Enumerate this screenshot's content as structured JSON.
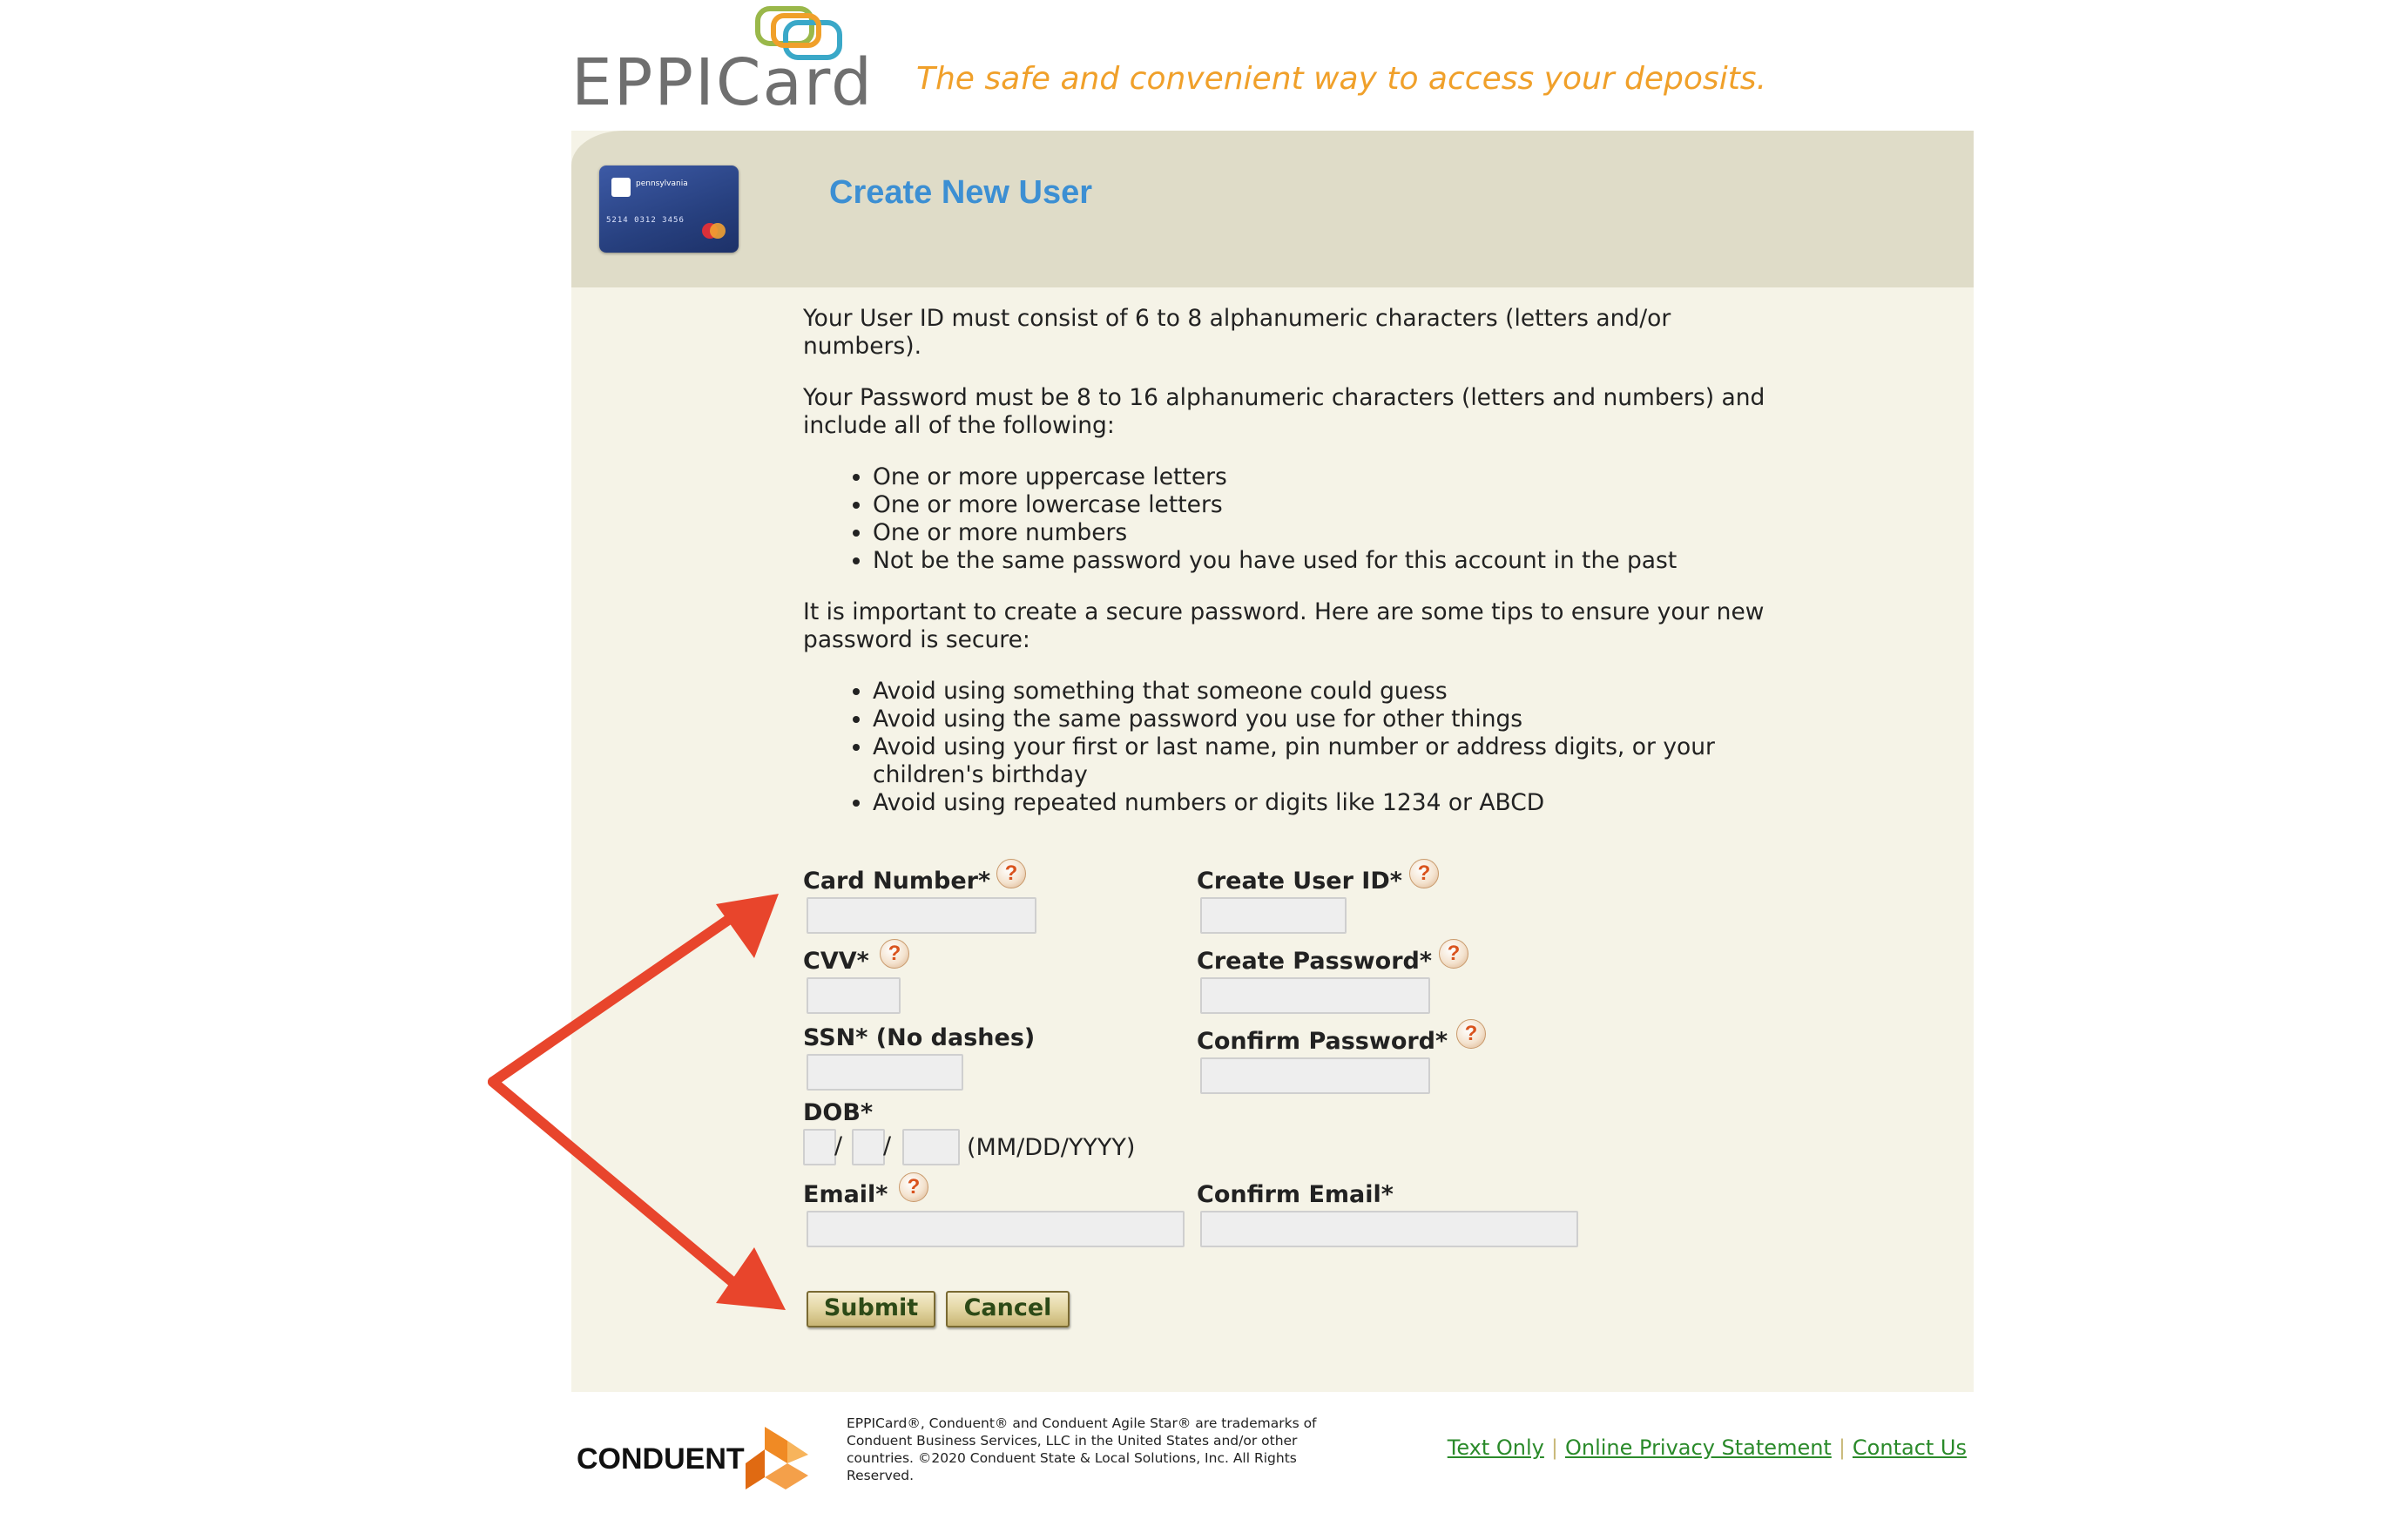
{
  "brand": {
    "logo_text": "EPPICard",
    "tagline": "The safe and convenient way to access your deposits."
  },
  "card": {
    "state": "pennsylvania",
    "digits": "5214 0312 3456"
  },
  "page": {
    "title": "Create New User"
  },
  "instructions": {
    "userid_rule": "Your User ID must consist of 6 to 8 alphanumeric characters (letters and/or numbers).",
    "password_rule": "Your Password must be 8 to 16 alphanumeric characters (letters and numbers) and include all of the following:",
    "password_items": [
      "One or more uppercase letters",
      "One or more lowercase letters",
      "One or more numbers",
      "Not be the same password you have used for this account in the past"
    ],
    "tips_intro": "It is important to create a secure password. Here are some tips to ensure your new password is secure:",
    "tips_items": [
      "Avoid using something that someone could guess",
      "Avoid using the same password you use for other things",
      "Avoid using your first or last name, pin number or address digits, or your children's birthday",
      "Avoid using repeated numbers or digits like 1234 or ABCD"
    ]
  },
  "form": {
    "card_number_label": "Card Number*",
    "cvv_label": "CVV*",
    "ssn_label": "SSN* (No dashes)",
    "dob_label": "DOB*",
    "dob_slash": "/",
    "dob_format": "(MM/DD/YYYY)",
    "email_label": "Email*",
    "create_userid_label": "Create User ID*",
    "create_password_label": "Create Password*",
    "confirm_password_label": "Confirm Password*",
    "confirm_email_label": "Confirm Email*",
    "help_glyph": "?",
    "values": {
      "card_number": "",
      "cvv": "",
      "ssn": "",
      "dob_mm": "",
      "dob_dd": "",
      "dob_yyyy": "",
      "email": "",
      "user_id": "",
      "password": "",
      "confirm_password": "",
      "confirm_email": ""
    }
  },
  "buttons": {
    "submit": "Submit",
    "cancel": "Cancel"
  },
  "footer": {
    "company": "CONDUENT",
    "legal": "EPPICard®, Conduent® and Conduent Agile Star® are trademarks of Conduent Business Services, LLC in the United States and/or other countries. ©2020 Conduent State & Local Solutions, Inc. All Rights Reserved.",
    "links": [
      "Text Only",
      "Online Privacy Statement",
      "Contact Us"
    ],
    "separator": "|"
  },
  "colors": {
    "title_blue": "#3c8fd3",
    "tagline_orange": "#f0a02a",
    "panel_bg": "#f5f3e7",
    "header_band": "#dfdcc8",
    "link_green": "#2a8a2a",
    "arrow_red": "#e8452c",
    "conduent_orange": "#f08a24"
  },
  "icons": {
    "help": "question-circle-icon",
    "annotation": "red-arrow-annotation"
  }
}
